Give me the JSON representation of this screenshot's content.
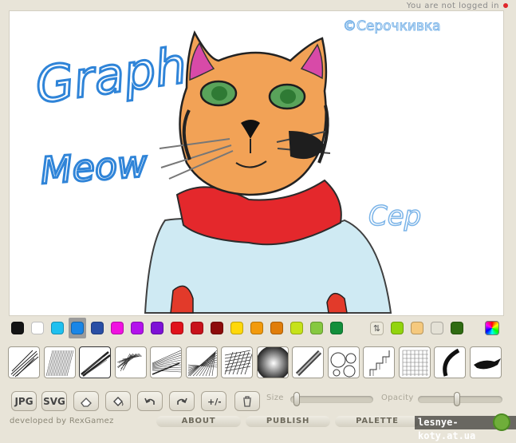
{
  "header": {
    "login_status": "You are not logged in"
  },
  "canvas": {
    "texts": {
      "graph": "Graph",
      "meow": "Meow",
      "signature": "©Серочкивка",
      "scribble": "Сер"
    }
  },
  "palette": {
    "colors": [
      "#141414",
      "#ffffff",
      "#1fc0ef",
      "#1a86e6",
      "#2a4fa5",
      "#f012e0",
      "#b312ec",
      "#7e12d6",
      "#e0121b",
      "#c8121b",
      "#8d0b0b",
      "#ffd80a",
      "#f29a0c",
      "#e07d0a",
      "#c6e21a",
      "#86c840",
      "#128f3c"
    ],
    "extra_colors": [
      "#92d40e",
      "#f5c97e",
      "#e4e1d6",
      "#2f6b12"
    ],
    "selected_index": 3
  },
  "brushes": [
    "sketchy",
    "shaded",
    "chrome",
    "fur",
    "longfur",
    "web",
    "squares",
    "ribbon",
    "circles",
    "grid",
    "curvy",
    "simple",
    "thin",
    "ink"
  ],
  "toolbar": {
    "jpg_label": "JPG",
    "svg_label": "SVG",
    "size_label": "Size",
    "opacity_label": "Opacity",
    "size_value": 0.04,
    "opacity_value": 0.42
  },
  "footer": {
    "developed_by": "developed by RexGamez",
    "about": "ABOUT",
    "publish": "PUBLISH",
    "palette": "PALETTE",
    "watermark": "lesnye-koty.at.ua"
  }
}
